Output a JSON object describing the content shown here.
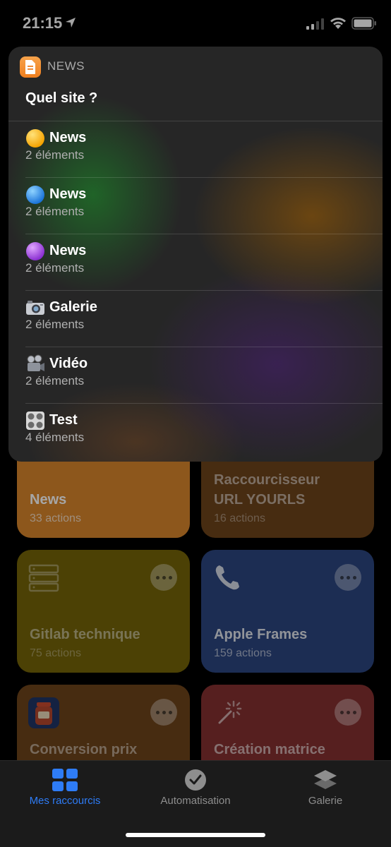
{
  "status": {
    "time": "21:15"
  },
  "popup": {
    "app_name": "NEWS",
    "prompt": "Quel site ?",
    "items": [
      {
        "icon": "yellow-circle",
        "label": "News",
        "count": "2 éléments"
      },
      {
        "icon": "blue-circle",
        "label": "News",
        "count": "2 éléments"
      },
      {
        "icon": "purple-circle",
        "label": "News",
        "count": "2 éléments"
      },
      {
        "icon": "camera",
        "label": "Galerie",
        "count": "2 éléments"
      },
      {
        "icon": "movie-camera",
        "label": "Vidéo",
        "count": "2 éléments"
      },
      {
        "icon": "control-knobs",
        "label": "Test",
        "count": "4 éléments"
      }
    ]
  },
  "cards": [
    {
      "title": "News",
      "subtitle": "33 actions",
      "color": "#e08a2c"
    },
    {
      "title_line1": "Raccourcisseur",
      "title_line2": "URL YOURLS",
      "subtitle": "16 actions",
      "color": "#7a4a1c"
    },
    {
      "title": "Gitlab technique",
      "subtitle": "75 actions",
      "color": "#7a6a08",
      "icon": "server-icon"
    },
    {
      "title": "Apple Frames",
      "subtitle": "159 actions",
      "color": "#2f4a86",
      "icon": "phone-icon"
    },
    {
      "title": "Conversion prix",
      "subtitle": "",
      "color": "#7a4a1c",
      "icon": "jar-icon"
    },
    {
      "title": "Création matrice",
      "subtitle": "",
      "color": "#8a3434",
      "icon": "magic-wand-icon"
    }
  ],
  "tabs": [
    {
      "label": "Mes raccourcis",
      "icon": "grid-icon",
      "active": true
    },
    {
      "label": "Automatisation",
      "icon": "clock-check-icon",
      "active": false
    },
    {
      "label": "Galerie",
      "icon": "layers-icon",
      "active": false
    }
  ],
  "colors": {
    "accent": "#2e7cf6"
  }
}
